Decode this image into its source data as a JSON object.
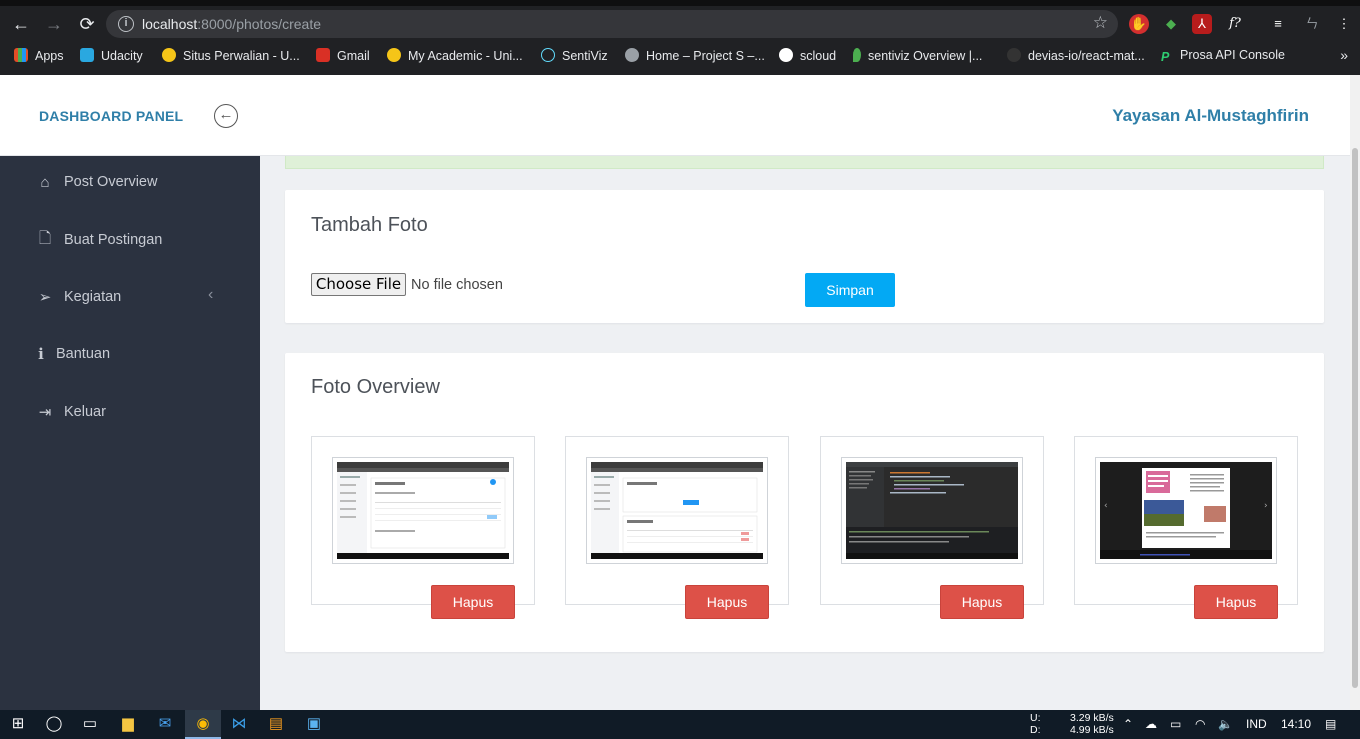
{
  "browser": {
    "url_host": "localhost",
    "url_rest": ":8000/photos/create",
    "bookmarks": [
      {
        "label": "Apps",
        "color": "#e44d26"
      },
      {
        "label": "Udacity",
        "color": "#2aa8e0"
      },
      {
        "label": "Situs Perwalian - U...",
        "color": "#f5c518"
      },
      {
        "label": "Gmail",
        "color": "#d93025"
      },
      {
        "label": "My Academic - Uni...",
        "color": "#f5c518"
      },
      {
        "label": "SentiViz",
        "color": "#61dafb"
      },
      {
        "label": "Home – Project S –...",
        "color": "#9aa0a6"
      },
      {
        "label": "scloud",
        "color": "#ffffff"
      },
      {
        "label": "sentiviz Overview |...",
        "color": "#4caf50"
      },
      {
        "label": "devias-io/react-mat...",
        "color": "#333333"
      },
      {
        "label": "Prosa API Console",
        "color": "#2ecc71"
      }
    ],
    "more": "»"
  },
  "header": {
    "brand": "DASHBOARD PANEL",
    "org_name": "Yayasan Al-Mustaghfirin"
  },
  "sidebar": {
    "items": [
      {
        "label": "Post Overview",
        "icon": "home-icon"
      },
      {
        "label": "Buat Postingan",
        "icon": "file-icon"
      },
      {
        "label": "Kegiatan",
        "icon": "paper-plane-icon"
      },
      {
        "label": "Bantuan",
        "icon": "info-icon"
      },
      {
        "label": "Keluar",
        "icon": "sign-out-icon"
      }
    ]
  },
  "upload": {
    "title": "Tambah Foto",
    "choose_label": "Choose File",
    "no_file": "No file chosen",
    "submit_label": "Simpan"
  },
  "gallery": {
    "title": "Foto Overview",
    "delete_label": "Hapus",
    "photos": [
      {
        "thumb_type": "dashboard-table-screenshot"
      },
      {
        "thumb_type": "dashboard-form-screenshot"
      },
      {
        "thumb_type": "code-editor-screenshot"
      },
      {
        "thumb_type": "document-viewer-screenshot"
      }
    ]
  },
  "taskbar": {
    "upload_label": "U:",
    "download_label": "D:",
    "upload_speed": "3.29 kB/s",
    "download_speed": "4.99 kB/s",
    "language": "IND",
    "time": "14:10"
  },
  "colors": {
    "accent": "#2f7fa8",
    "primary_button": "#03a9f4",
    "danger_button": "#dd5148",
    "sidebar_bg": "#2b3240"
  }
}
